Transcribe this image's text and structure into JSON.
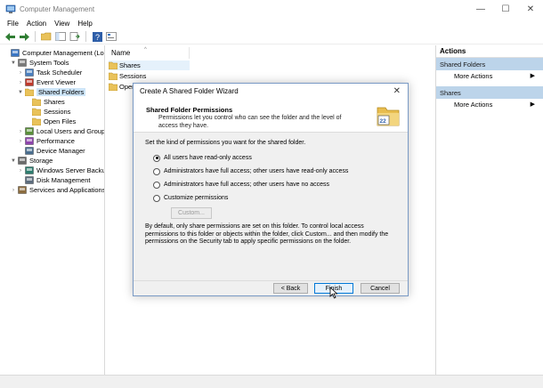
{
  "window": {
    "title": "Computer Management",
    "controls": {
      "minimize": "—",
      "maximize": "☐",
      "close": "✕"
    }
  },
  "menu": [
    "File",
    "Action",
    "View",
    "Help"
  ],
  "toolbar_icons": [
    "back-arrow-icon",
    "forward-arrow-icon",
    "up-folder-icon",
    "show-hide-tree-icon",
    "export-list-icon",
    "help-icon",
    "properties-icon"
  ],
  "tree": {
    "items": [
      {
        "label": "Computer Management (Local",
        "level": 0,
        "expander": "",
        "icon": "computer-management-icon"
      },
      {
        "label": "System Tools",
        "level": 1,
        "expander": "▼",
        "icon": "system-tools-icon"
      },
      {
        "label": "Task Scheduler",
        "level": 2,
        "expander": "›",
        "icon": "task-scheduler-icon"
      },
      {
        "label": "Event Viewer",
        "level": 2,
        "expander": "›",
        "icon": "event-viewer-icon"
      },
      {
        "label": "Shared Folders",
        "level": 2,
        "expander": "▼",
        "icon": "shared-folders-icon",
        "selected": true
      },
      {
        "label": "Shares",
        "level": 3,
        "expander": "",
        "icon": "shares-folder-icon"
      },
      {
        "label": "Sessions",
        "level": 3,
        "expander": "",
        "icon": "sessions-folder-icon"
      },
      {
        "label": "Open Files",
        "level": 3,
        "expander": "",
        "icon": "open-files-folder-icon"
      },
      {
        "label": "Local Users and Groups",
        "level": 2,
        "expander": "›",
        "icon": "users-groups-icon"
      },
      {
        "label": "Performance",
        "level": 2,
        "expander": "›",
        "icon": "performance-icon"
      },
      {
        "label": "Device Manager",
        "level": 2,
        "expander": "",
        "icon": "device-manager-icon"
      },
      {
        "label": "Storage",
        "level": 1,
        "expander": "▼",
        "icon": "storage-icon"
      },
      {
        "label": "Windows Server Backup",
        "level": 2,
        "expander": "›",
        "icon": "windows-server-backup-icon"
      },
      {
        "label": "Disk Management",
        "level": 2,
        "expander": "",
        "icon": "disk-management-icon"
      },
      {
        "label": "Services and Applications",
        "level": 1,
        "expander": "›",
        "icon": "services-applications-icon"
      }
    ]
  },
  "list": {
    "column": "Name",
    "rows": [
      "Shares",
      "Sessions",
      "Open"
    ]
  },
  "actions": {
    "title": "Actions",
    "sections": [
      {
        "header": "Shared Folders",
        "items": [
          "More Actions"
        ]
      },
      {
        "header": "Shares",
        "items": [
          "More Actions"
        ]
      }
    ]
  },
  "dialog": {
    "title": "Create A Shared Folder Wizard",
    "close": "✕",
    "header_title": "Shared Folder Permissions",
    "header_subtitle": "Permissions let you control who can see the folder and the level of access they have.",
    "prompt": "Set the kind of permissions you want for the shared folder.",
    "options": [
      {
        "label": "All users have read-only access",
        "selected": true
      },
      {
        "label": "Administrators have full access; other users have read-only access",
        "selected": false
      },
      {
        "label": "Administrators have full access; other users have no access",
        "selected": false
      },
      {
        "label": "Customize permissions",
        "selected": false
      }
    ],
    "custom_button": "Custom...",
    "note": "By default, only share permissions are set on this folder. To control local access permissions to this folder or objects within the folder, click Custom... and then modify the permissions on the Security tab to apply specific permissions on the folder.",
    "buttons": {
      "back": "< Back",
      "finish": "Finish",
      "cancel": "Cancel"
    }
  },
  "colors": {
    "selection": "#cce4f7",
    "action_header": "#bcd4ea",
    "default_button": "#0078d7",
    "dialog_border": "#7a9ac5"
  }
}
